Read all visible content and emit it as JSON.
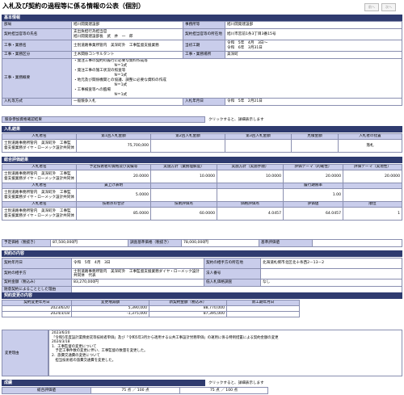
{
  "page": {
    "title": "入札及び契約の過程等に係る情報の公表（個別）",
    "nav_prev": "前へ",
    "nav_next": "次へ"
  },
  "basic": {
    "header": "基本情報",
    "dept_label": "部局",
    "dept": "旭川開発建設部",
    "office_label": "事務所等",
    "office": "旭川開発建設部",
    "official_label": "契約担当官等の氏名",
    "official": "支出負担行為担当官\n旭川開発建設部長　武　井　一　郎",
    "official_addr_label": "契約担当官等の所在地",
    "official_addr": "旭川市宮前1条3丁目3番15号",
    "work_name_label": "工事・業務名",
    "work_name": "士別道路事業所管内　美深町外　工事監督支援業務",
    "period_label": "当初工期",
    "period": "令和　5年　4月　3日～\n令和　6年　3月31日",
    "category_label": "工事・業務区分",
    "category": "土木関係コンサルタント",
    "place_label": "工事・業務場所",
    "place": "美深町",
    "summary_label": "工事・業務概要",
    "summary": "・発注工事の契約の履行に必要な資料作成等\n　　　　　　　　　　　N＝1式\n・発注工事の施工状況の照査等\n　　　　　　　　　　　N＝1式\n・地元及び関係機関との協議、調整に必要な資料の作成\n　　　　　　　　　　　N＝1式\n・工事検査等への臨場\n　　　　　　　　　　　N＝1式",
    "method_label": "入札等方式",
    "method": "一般競争入札",
    "bid_date_label": "入札年月日",
    "bid_date": "令和　5年　2月21日"
  },
  "participants": {
    "button": "競争参加資格確認結果",
    "note": "クリックすると、詳細表示します"
  },
  "bid_results": {
    "header": "入札結果",
    "columns": [
      "入札者名",
      "第1回入札金額",
      "第2回入札金額",
      "第3回入札金額",
      "見積金額",
      "入札者の措置"
    ],
    "rows": [
      [
        "士別道路事務所管内　美深町外　工事監督支援業務ダイヤ・ローメック設計共同体",
        "75,700,000",
        "",
        "",
        "",
        "落札"
      ]
    ]
  },
  "evaluation": {
    "header": "総合評価結果",
    "cols1": [
      "入札者名",
      "予定技術者の資格及び実績等",
      "実施方針（業務理解度）",
      "実施方針（実施手順）",
      "評価テーマ（的確性）",
      "評価テーマ（実現性）"
    ],
    "row1": [
      "士別道路事務所管内　美深町外　工事監督支援業務ダイヤ・ローメック設計共同体",
      "20.0000",
      "10.0000",
      "10.0000",
      "20.0000",
      "20.0000"
    ],
    "cols2": [
      "入札者名",
      "賃上げ表明",
      "",
      "",
      "履行期限率",
      ""
    ],
    "row2": [
      "士別道路事務所管内　美深町外　工事監督支援業務ダイヤ・ローメック設計共同体",
      "5.0000",
      "",
      "",
      "1.00",
      ""
    ],
    "cols3": [
      "入札者名",
      "技術点の合計",
      "技術評価点",
      "価格評価点",
      "評価値",
      "順位"
    ],
    "row3": [
      "士別道路事務所管内　美深町外　工事監督支援業務ダイヤ・ローメック設計共同体",
      "85.0000",
      "60.0000",
      "4.0457",
      "64.0457",
      "1"
    ]
  },
  "prices": {
    "planned_label": "予定価格（税抜き）",
    "planned": "87,500,000円",
    "base_label": "調査基準価格（税抜き）",
    "base": "78,000,000円",
    "eval_base_label": "基準評価値",
    "eval_base": ""
  },
  "contract": {
    "header": "契約の内容",
    "date_label": "契約年月日",
    "date": "令和　5年　4月　3日",
    "partner_addr_label": "契約の相手方の所在地",
    "partner_addr": "北海道札幌市北区北十条西2－13－2",
    "partner_label": "契約の相手方",
    "partner": "士別道路事務所管内　美深町外　工事監督支援業務ダイヤ・ローメック設計共同体　代表",
    "bidder_count_label": "法人番号",
    "bidder_count": "",
    "amount_label": "契約金額（税込み）",
    "amount": "83,270,000円",
    "other_label": "低入札価格調査",
    "other": "なし",
    "free_label": "随意契約によることとした理由",
    "free": ""
  },
  "changes": {
    "header": "契約変更の内容",
    "columns": [
      "契約変更年月日",
      "変更増減額",
      "新契約金額（税込み）",
      "新工期年月日"
    ],
    "rows": [
      [
        "2023/6/20",
        "5,390,000",
        "88,770,000",
        ""
      ],
      [
        "2024/3/18",
        "-1,375,000",
        "87,395,000",
        ""
      ]
    ],
    "reason_label": "変更理由",
    "reason": "2023/6/20\n「令和5年度設計業務委託等技術者単価」及び「令和5年3月から適用する公共工事設計労務単価」の運用に係る特例措置による契約金額の変更\n2024/3/18\n1．工事監督の変更について\n　予定工事件数の変更に伴い、工事監督の数量を変更した。\n2．旅費交通費の変更について\n　担当技術者の旅費交通費を変更した。"
  },
  "performance": {
    "header": "成績",
    "note": "クリックすると、詳細表示します",
    "columns": [
      "総合評価値",
      "",
      ""
    ],
    "row": [
      "",
      "75 点 ／ 100 点",
      "75 点 ／ 100 点"
    ]
  }
}
